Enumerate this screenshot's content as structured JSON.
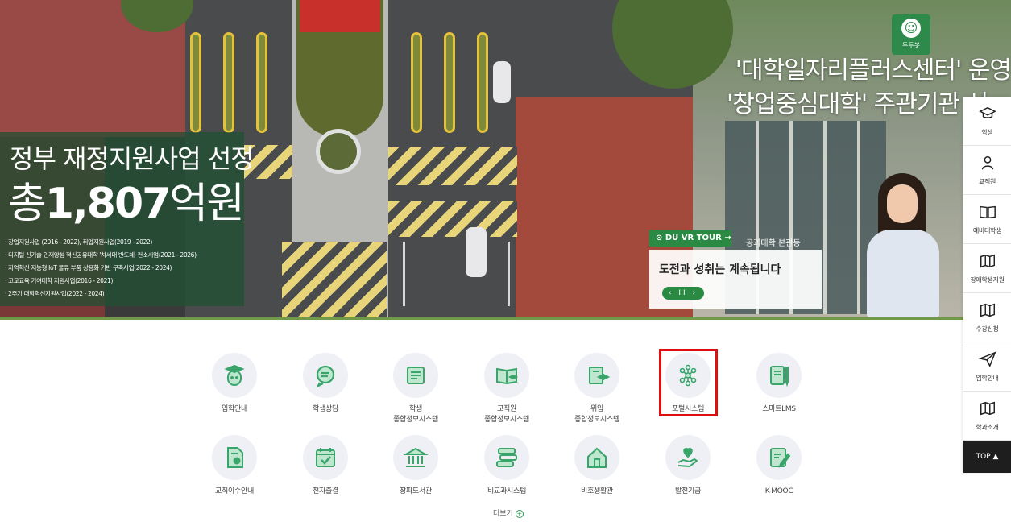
{
  "hero": {
    "title_line1": "정부 재정지원사업 선정",
    "title_line2_prefix": "총",
    "title_line2_number": "1,807",
    "title_line2_suffix": "억원",
    "bullets": [
      "· 창업지원사업 (2016 - 2022), 취업지원사업(2019 - 2022)",
      "· 디지털 신기술 인재양성 혁신공유대학 '차세대 반도체' 컨소시엄(2021 - 2026)",
      "· 지역혁신 지능형 IoT 물류 부품 상용화 기반 구축사업(2022 - 2024)",
      "· 고교교육 기여대학 지원사업(2016 - 2021)",
      "· 2주기 대학혁신지원사업(2022 - 2024)"
    ],
    "right_title_line1": "'대학일자리플러스센터' 운영",
    "right_title_line2": "'창업중심대학' 주관기관 선",
    "mascot_label": "두두봇",
    "building_sign": "공과대학 본관동",
    "vr_tag": "DU VR TOUR →",
    "vr_caption": "도전과 성취는 계속됩니다",
    "vr_controls": "‹ II ›"
  },
  "quick_menu": {
    "row1": [
      {
        "label": "입학안내",
        "icon": "graduate-face-icon"
      },
      {
        "label": "학생상담",
        "icon": "chat-bubble-icon"
      },
      {
        "label": "학생\n종합정보시스템",
        "icon": "student-certificate-icon"
      },
      {
        "label": "교직원\n종합정보시스템",
        "icon": "staff-book-icon"
      },
      {
        "label": "위입\n종합정보시스템",
        "icon": "book-cap-icon"
      },
      {
        "label": "포털시스템",
        "icon": "network-icon"
      },
      {
        "label": "스마트LMS",
        "icon": "notebook-pen-icon"
      }
    ],
    "row2": [
      {
        "label": "교직이수안내",
        "icon": "certificate-icon"
      },
      {
        "label": "전자출결",
        "icon": "calendar-check-icon"
      },
      {
        "label": "창파도서관",
        "icon": "library-icon"
      },
      {
        "label": "비교과시스템",
        "icon": "books-stack-icon"
      },
      {
        "label": "비호생활관",
        "icon": "dormitory-icon"
      },
      {
        "label": "발전기금",
        "icon": "hand-heart-icon"
      },
      {
        "label": "K-MOOC",
        "icon": "edit-document-icon"
      }
    ],
    "more_label": "더보기"
  },
  "side_menu": {
    "items": [
      {
        "label": "학생",
        "icon": "graduation-cap-icon"
      },
      {
        "label": "교직원",
        "icon": "person-icon"
      },
      {
        "label": "예비대학생",
        "icon": "open-book-icon"
      },
      {
        "label": "장애학생지원",
        "icon": "map-icon"
      },
      {
        "label": "수강신청",
        "icon": "map-icon"
      },
      {
        "label": "입학안내",
        "icon": "paper-plane-icon"
      },
      {
        "label": "학과소개",
        "icon": "map-icon"
      }
    ],
    "top_label": "TOP ▲"
  },
  "colors": {
    "brand_green": "#2a8a43",
    "icon_green": "#3aa56b",
    "highlight_red": "#e10e0e",
    "circle_bg": "#eef0f5"
  }
}
